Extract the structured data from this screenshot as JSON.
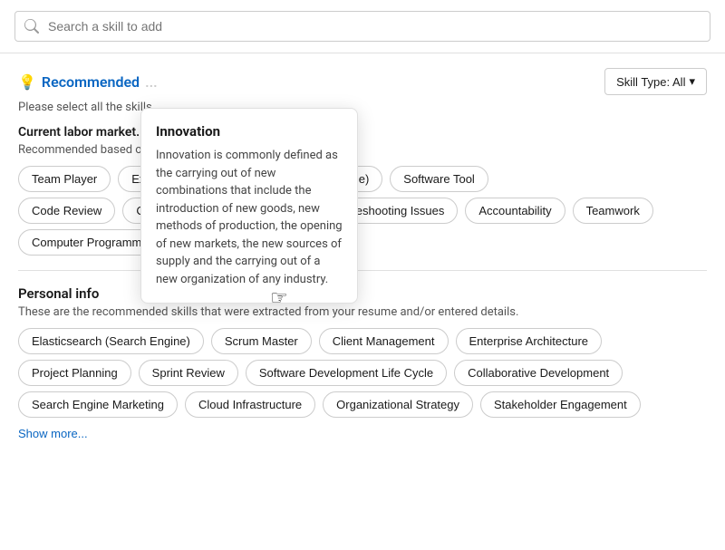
{
  "search": {
    "placeholder": "Search a skill to add"
  },
  "recommended_section": {
    "title": "Recommended",
    "subtitle_truncated": "Please select all the skills...",
    "skill_type_label": "Skill Type: All"
  },
  "current_labor_market": {
    "label": "Current labor market...",
    "desc": "Recommended based on..."
  },
  "labor_skills_row1": [
    "Team Player",
    "Excel",
    "Python (Programming Language)",
    "Software Tool"
  ],
  "labor_skills_row2": [
    "Code Review",
    "Co-Creation",
    "Innovation",
    "Troubleshooting Issues",
    "Accountability",
    "Teamwork"
  ],
  "labor_skills_row3": [
    "Computer Programming"
  ],
  "show_more_label": "Show more...",
  "tooltip": {
    "title": "Innovation",
    "body": "Innovation is commonly defined as the carrying out of new combinations that include the introduction of new goods, new methods of production, the opening of new markets, the new sources of supply and the carrying out of a new organization of any industry."
  },
  "personal_info": {
    "title": "Personal info",
    "desc": "These are the recommended skills that were extracted from your resume and/or entered details."
  },
  "personal_skills_row1": [
    "Elasticsearch (Search Engine)",
    "Scrum Master",
    "Client Management",
    "Enterprise Architecture"
  ],
  "personal_skills_row2": [
    "Project Planning",
    "Sprint Review",
    "Software Development Life Cycle",
    "Collaborative Development"
  ],
  "personal_skills_row3": [
    "Search Engine Marketing",
    "Cloud Infrastructure",
    "Organizational Strategy",
    "Stakeholder Engagement"
  ],
  "personal_show_more": "Show more..."
}
